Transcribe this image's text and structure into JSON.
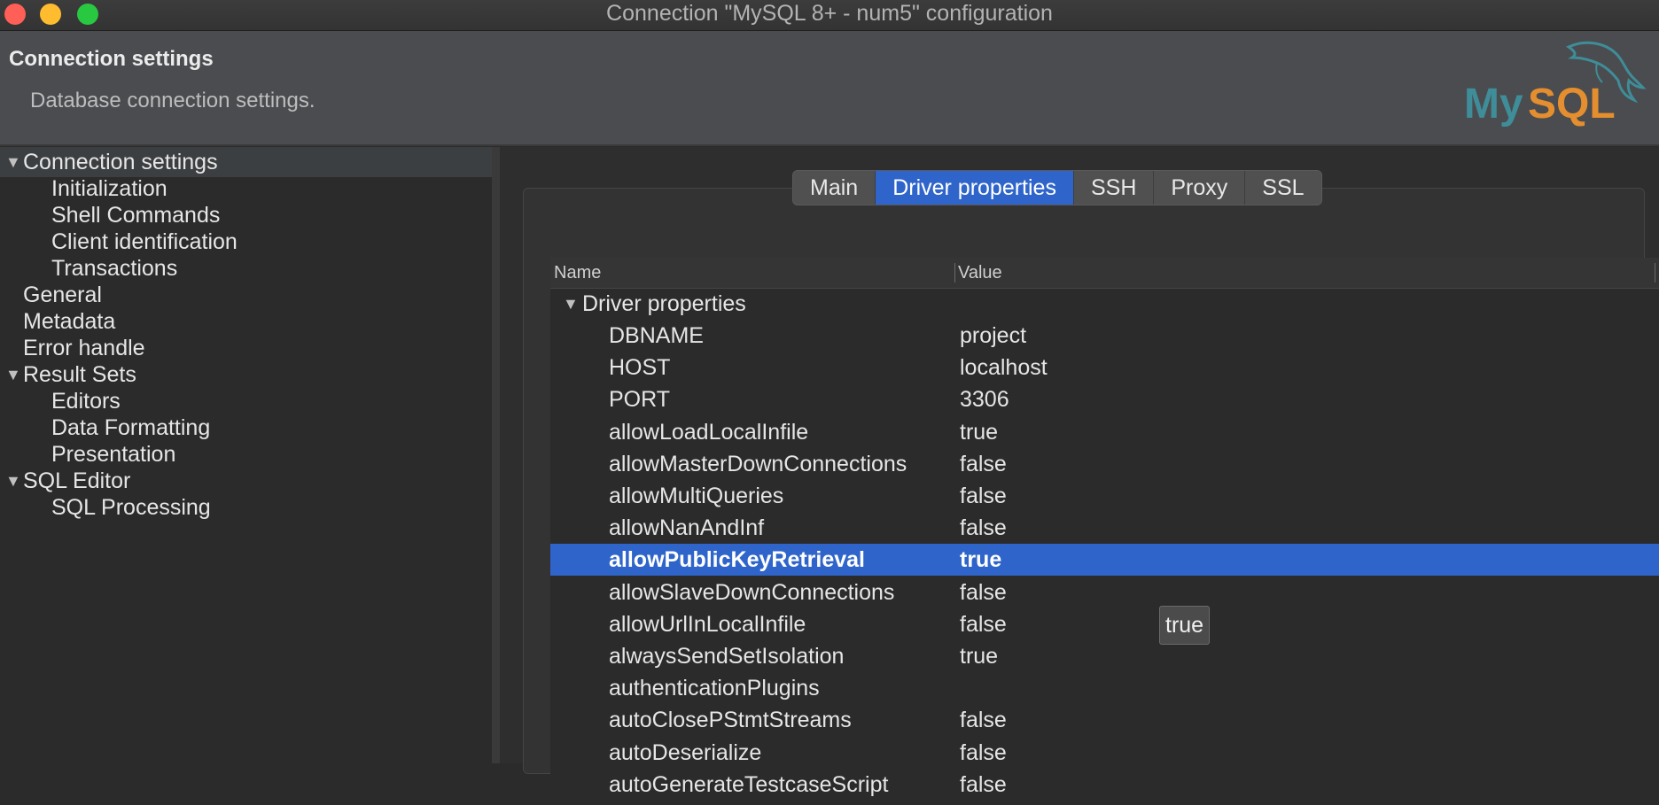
{
  "window": {
    "title": "Connection \"MySQL 8+ - num5\" configuration"
  },
  "header": {
    "title": "Connection settings",
    "description": "Database connection settings.",
    "logo_text": "MySQL"
  },
  "nav": {
    "items": [
      {
        "label": "Connection settings",
        "expanded": true
      },
      {
        "label": "Initialization"
      },
      {
        "label": "Shell Commands"
      },
      {
        "label": "Client identification"
      },
      {
        "label": "Transactions"
      },
      {
        "label": "General"
      },
      {
        "label": "Metadata"
      },
      {
        "label": "Error handle"
      },
      {
        "label": "Result Sets",
        "expanded": true
      },
      {
        "label": "Editors"
      },
      {
        "label": "Data Formatting"
      },
      {
        "label": "Presentation"
      },
      {
        "label": "SQL Editor",
        "expanded": true
      },
      {
        "label": "SQL Processing"
      }
    ]
  },
  "tabs": [
    "Main",
    "Driver properties",
    "SSH",
    "Proxy",
    "SSL"
  ],
  "active_tab": "Driver properties",
  "table": {
    "columns": {
      "name": "Name",
      "value": "Value"
    },
    "group_label": "Driver properties",
    "rows": [
      {
        "name": "DBNAME",
        "value": "project"
      },
      {
        "name": "HOST",
        "value": "localhost"
      },
      {
        "name": "PORT",
        "value": "3306"
      },
      {
        "name": "allowLoadLocalInfile",
        "value": "true"
      },
      {
        "name": "allowMasterDownConnections",
        "value": "false"
      },
      {
        "name": "allowMultiQueries",
        "value": "false"
      },
      {
        "name": "allowNanAndInf",
        "value": "false"
      },
      {
        "name": "allowPublicKeyRetrieval",
        "value": "true",
        "selected": true
      },
      {
        "name": "allowSlaveDownConnections",
        "value": "false"
      },
      {
        "name": "allowUrlInLocalInfile",
        "value": "false"
      },
      {
        "name": "alwaysSendSetIsolation",
        "value": "true"
      },
      {
        "name": "authenticationPlugins",
        "value": ""
      },
      {
        "name": "autoClosePStmtStreams",
        "value": "false"
      },
      {
        "name": "autoDeserialize",
        "value": "false"
      },
      {
        "name": "autoGenerateTestcaseScript",
        "value": "false"
      }
    ]
  },
  "tooltip": {
    "text": "true"
  },
  "colors": {
    "selection": "#2f65ca",
    "logo_teal": "#3f8d98",
    "logo_orange": "#e48e2f"
  }
}
